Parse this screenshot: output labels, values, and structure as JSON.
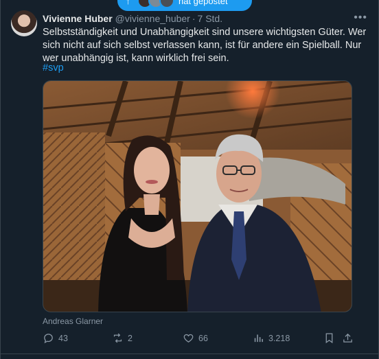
{
  "reposted": {
    "label": "hat gepostet"
  },
  "tweet": {
    "author_name": "Vivienne Huber",
    "author_handle": "@vivienne_huber",
    "time_separator": "·",
    "time": "7 Std.",
    "text": "Selbstständigkeit und Unabhängigkeit sind unsere wichtigsten Güter. Wer sich nicht auf sich selbst verlassen kann, ist für andere ein Spielball. Nur wer unabhängig ist, kann wirklich frei sein.",
    "hashtag": "#svp",
    "media_credit": "Andreas Glarner"
  },
  "actions": {
    "replies": "43",
    "reposts": "2",
    "likes": "66",
    "views": "3.218"
  },
  "icons": {
    "more": "more-icon",
    "reply": "reply-icon",
    "repost": "repost-icon",
    "like": "heart-icon",
    "views": "views-icon",
    "bookmark": "bookmark-icon",
    "share": "share-icon"
  },
  "colors": {
    "background": "#15202b",
    "accent": "#1d9bf0",
    "secondary_text": "#8b98a5",
    "primary_text": "#e7e9ea"
  }
}
